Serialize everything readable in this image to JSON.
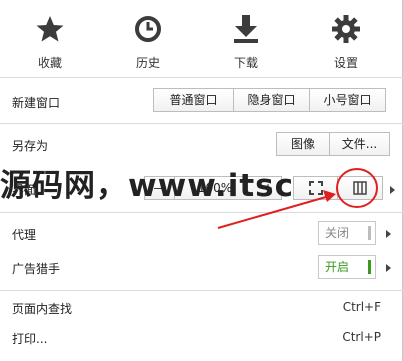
{
  "toolbar": {
    "favorites": "收藏",
    "history": "历史",
    "downloads": "下载",
    "settings": "设置"
  },
  "new_window": {
    "label": "新建窗口",
    "normal": "普通窗口",
    "incognito": "隐身窗口",
    "mini": "小号窗口"
  },
  "save_as": {
    "label": "另存为",
    "image": "图像",
    "file": "文件..."
  },
  "interface": {
    "label": "界面",
    "zoom_out": "—",
    "zoom": "100%",
    "zoom_in": "+"
  },
  "proxy": {
    "label": "代理",
    "state": "关闭",
    "state_color": "#bdbdbd"
  },
  "adblock": {
    "label": "广告猎手",
    "state": "开启",
    "state_color": "#3a9a1d"
  },
  "find": {
    "label": "页面内查找",
    "shortcut": "Ctrl+F"
  },
  "print": {
    "label": "打印...",
    "shortcut": "Ctrl+P"
  },
  "watermark": "源码网，www.itsc",
  "annotation_color": "#e02020"
}
